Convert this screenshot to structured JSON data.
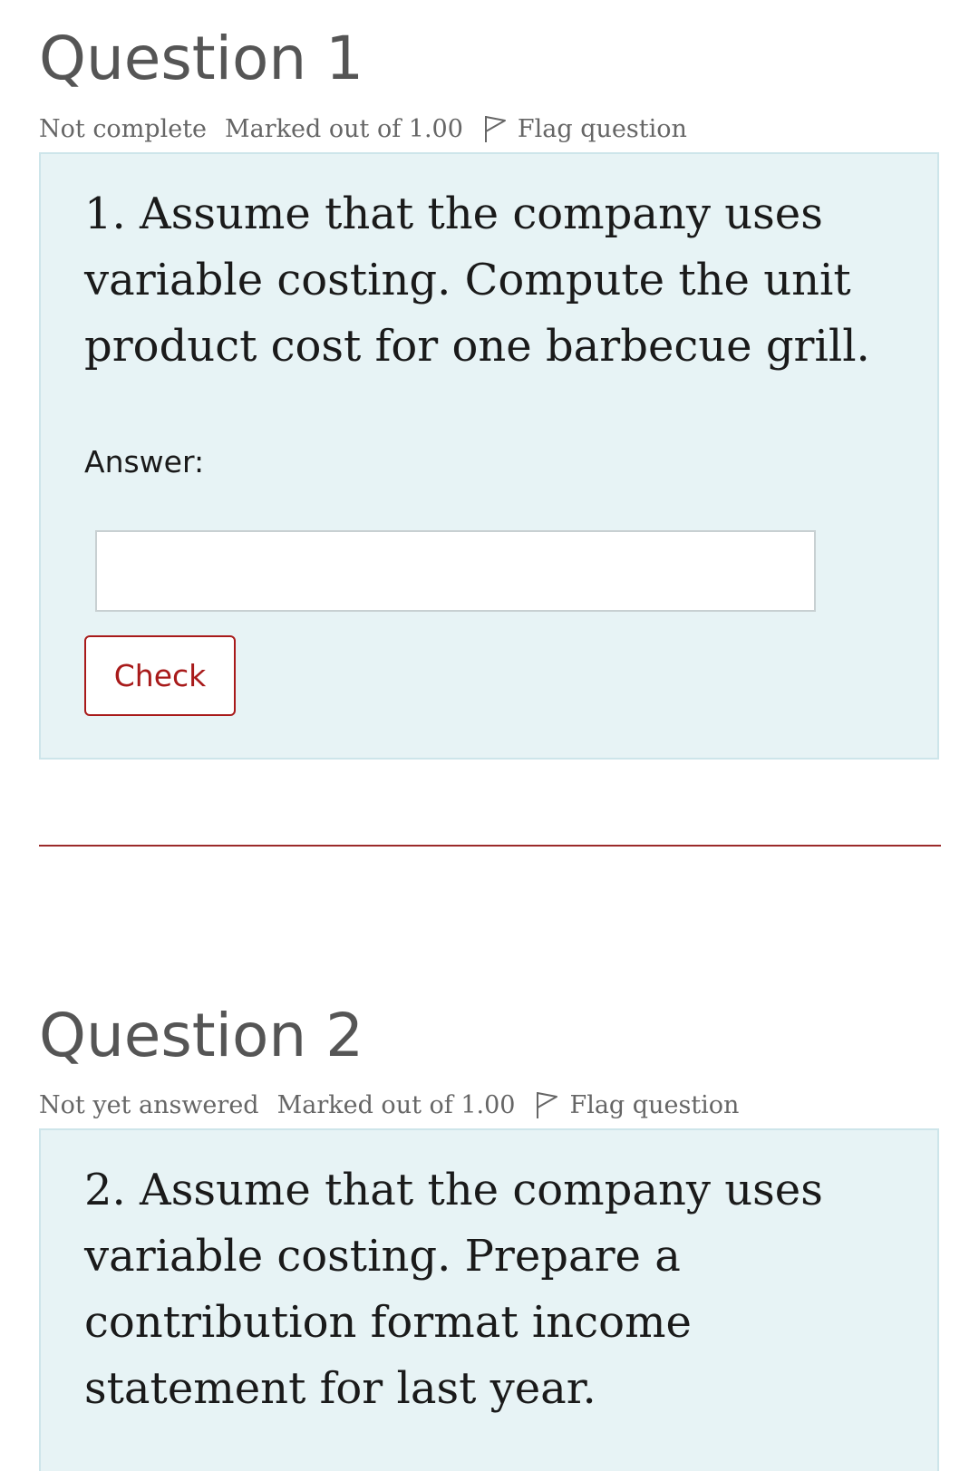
{
  "question1": {
    "title": "Question 1",
    "state": "Not complete",
    "grade": "Marked out of 1.00",
    "flag_label": "Flag question",
    "text": "1. Assume that the company uses variable costing. Compute the unit product cost for one barbecue grill.",
    "answer_label": "Answer:",
    "answer_value": "",
    "check_label": "Check"
  },
  "question2": {
    "title": "Question 2",
    "state": "Not yet answered",
    "grade": "Marked out of 1.00",
    "flag_label": "Flag question",
    "text": "2. Assume that the company uses variable costing. Prepare a contribution format income statement for last year."
  },
  "colors": {
    "question_bg": "#e7f3f5",
    "question_border": "#cde5ea",
    "accent": "#a81a1a",
    "title_text": "#555555",
    "meta_text": "#666666"
  },
  "icons": {
    "flag": "flag-icon"
  }
}
